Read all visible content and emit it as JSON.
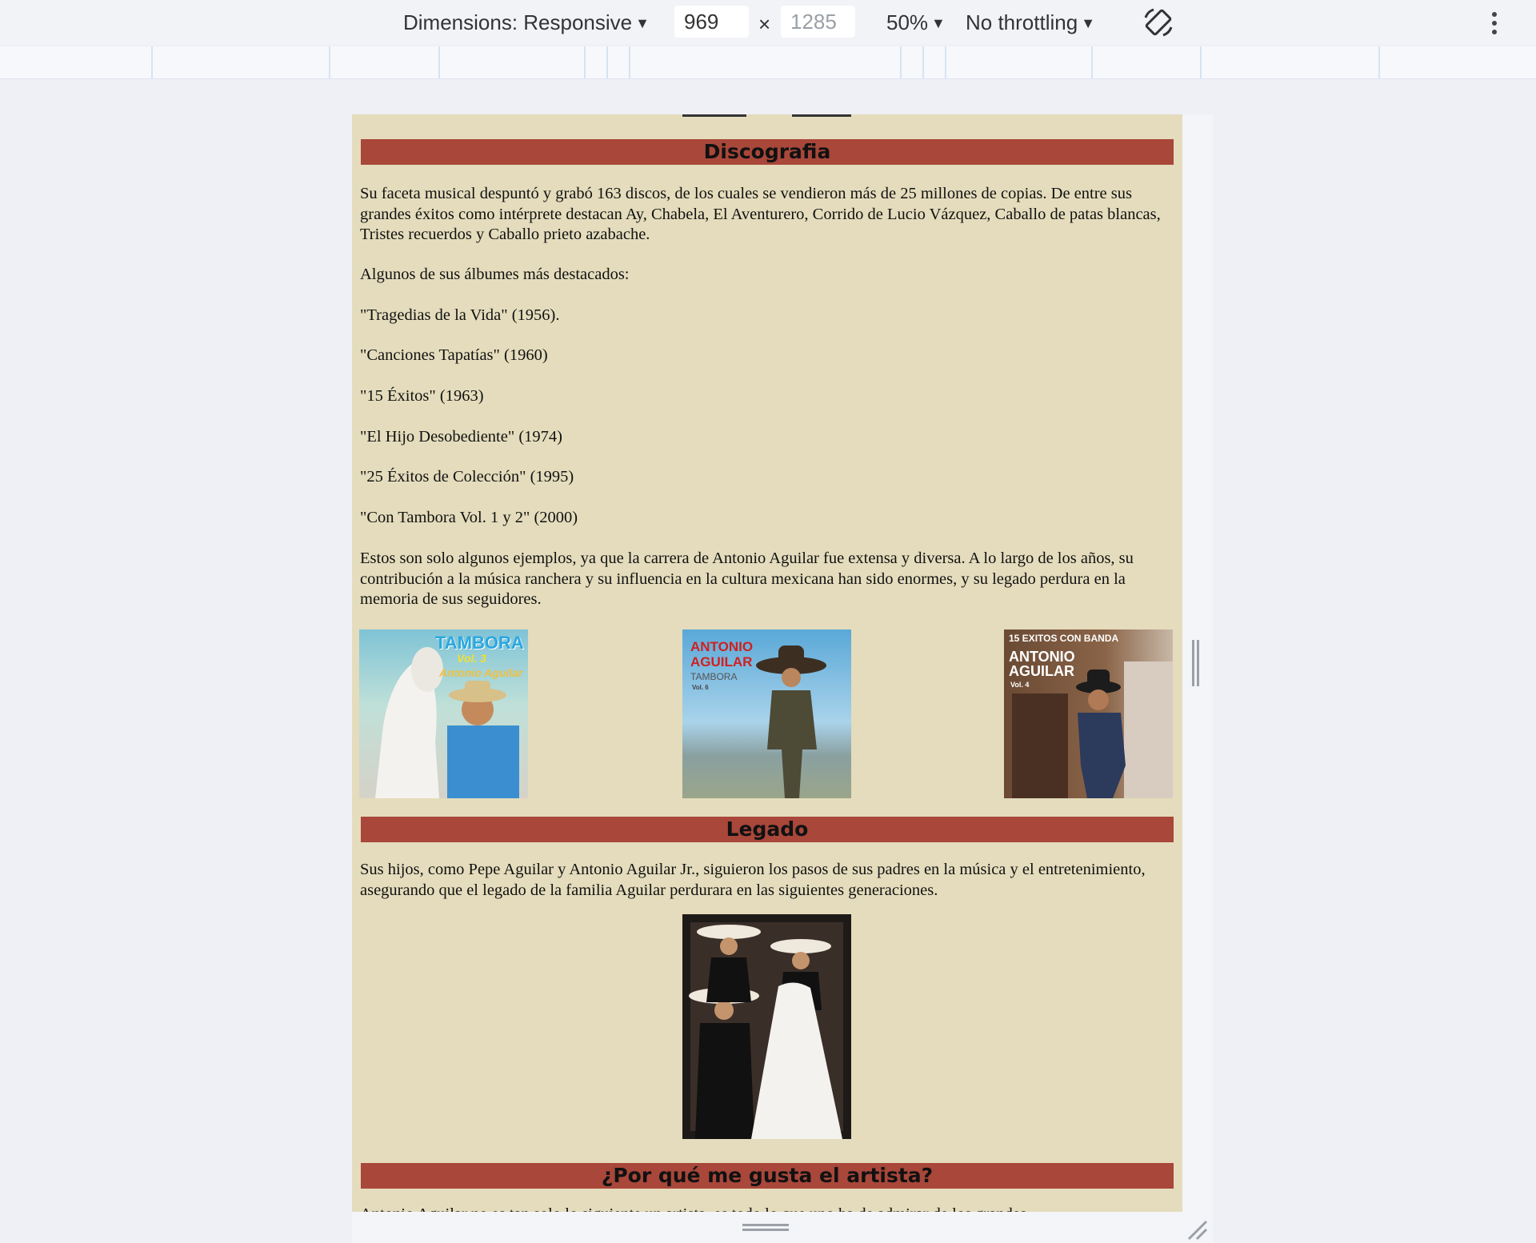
{
  "devtools": {
    "dimensions_label": "Dimensions: Responsive",
    "width_value": "969",
    "times": "×",
    "height_value": "1285",
    "zoom": "50%",
    "throttling": "No throttling"
  },
  "page": {
    "discografia": {
      "title": "Discografia",
      "intro": "Su faceta musical despuntó y grabó 163 discos, de los cuales se vendieron más de 25 millones de copias. De entre sus grandes éxitos como intérprete destacan Ay, Chabela, El Aventurero, Corrido de Lucio Vázquez, Caballo de patas blancas, Tristes recuerdos y Caballo prieto azabache.",
      "albums_lead": "Algunos de sus álbumes más destacados:",
      "albums": [
        "\"Tragedias de la Vida\" (1956).",
        "\"Canciones Tapatías\" (1960)",
        "\"15 Éxitos\" (1963)",
        "\"El Hijo Desobediente\" (1974)",
        "\"25 Éxitos de Colección\" (1995)",
        "\"Con Tambora Vol. 1 y 2\" (2000)"
      ],
      "closing": "Estos son solo algunos ejemplos, ya que la carrera de Antonio Aguilar fue extensa y diversa. A lo largo de los años, su contribución a la música ranchera y su influencia en la cultura mexicana han sido enormes, y su legado perdura en la memoria de sus seguidores."
    },
    "covers": {
      "cover1": {
        "line1": "TAMBORA",
        "line2": "Vol. 3",
        "line3": "Antonio Aguilar"
      },
      "cover2": {
        "line1": "ANTONIO",
        "line2": "AGUILAR",
        "line3": "TAMBORA",
        "line4": "Vol. 6"
      },
      "cover3": {
        "line1": "15 EXITOS CON BANDA",
        "line2": "ANTONIO",
        "line3": "AGUILAR",
        "line4": "Vol. 4"
      }
    },
    "legado": {
      "title": "Legado",
      "text": "Sus hijos, como Pepe Aguilar y Antonio Aguilar Jr., siguieron los pasos de sus padres en la música y el entretenimiento, asegurando que el legado de la familia Aguilar perdurara en las siguientes generaciones."
    },
    "porque": {
      "title": "¿Por qué me gusta el artista?",
      "cut_text": "Antonio Aguilar no es tan solo lo siguiente un artista, es todo lo que uno ha de admirar de los grandes"
    }
  },
  "colors": {
    "page_bg": "#e4dcbc",
    "section_head_bg": "#a8473a",
    "devtools_bg": "#f1f3f7"
  }
}
